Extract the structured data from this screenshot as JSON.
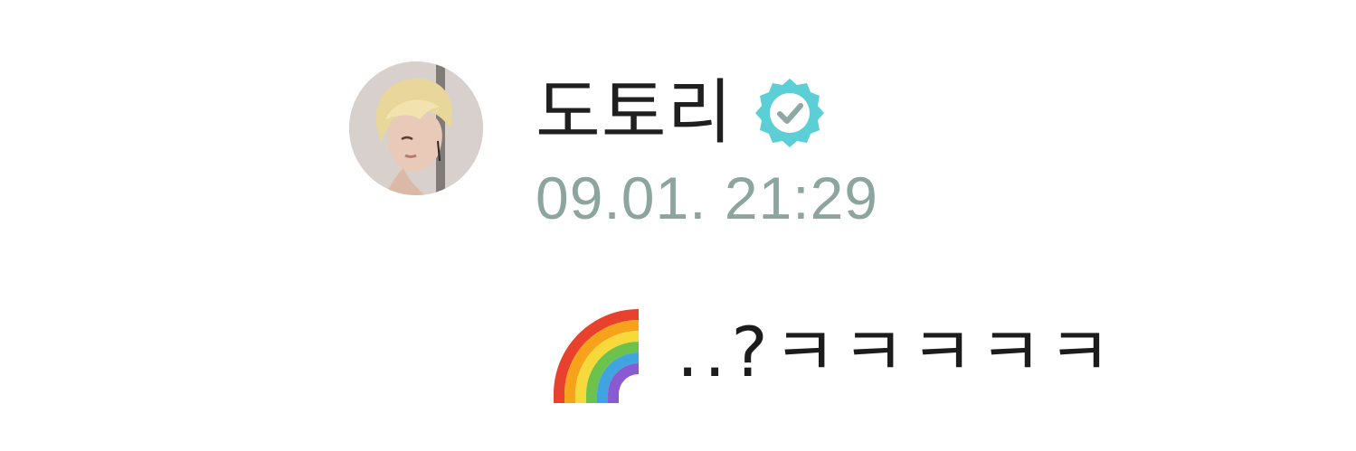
{
  "post": {
    "author": {
      "name": "도토리",
      "verified": true,
      "badge_color": "#5ccfd6",
      "avatar_icon": "profile-avatar"
    },
    "timestamp": "09.01. 21:29",
    "message": {
      "emoji": "rainbow-icon",
      "text": "..?ㅋㅋㅋㅋㅋ"
    }
  },
  "colors": {
    "name": "#1f1f1f",
    "timestamp": "#8ca59f",
    "text": "#1c1c1c",
    "background": "#ffffff"
  }
}
